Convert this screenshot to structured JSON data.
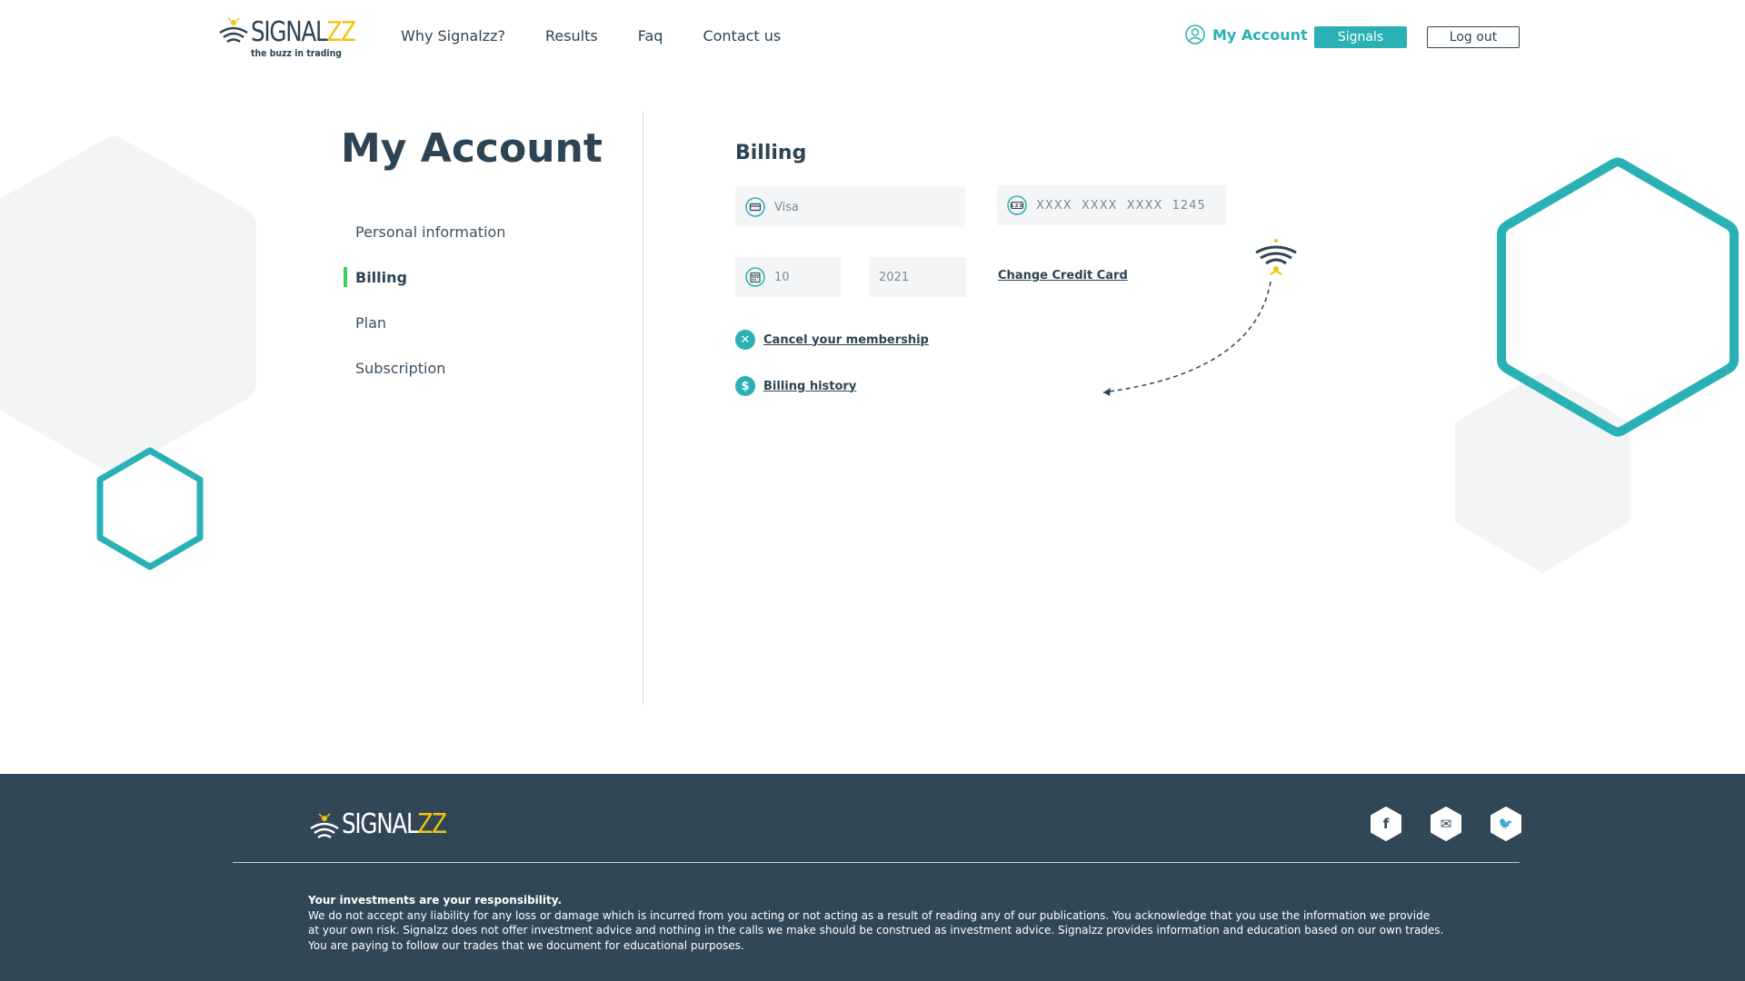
{
  "brand": {
    "name_dark": "SIGNAL",
    "name_accent": "ZZ",
    "tagline": "the buzz in trading",
    "colors": {
      "teal": "#29b1b5",
      "navy": "#2d4454",
      "yellow": "#f1c40f",
      "green": "#35d65c",
      "footer": "#314756"
    }
  },
  "nav": {
    "items": [
      "Why Signalzz?",
      "Results",
      "Faq",
      "Contact us"
    ],
    "account_label": "My Account",
    "account_icon": "user-circle-icon",
    "signals_label": "Signals",
    "logout_label": "Log out"
  },
  "sidebar": {
    "title": "My Account",
    "items": [
      {
        "label": "Personal information",
        "active": false
      },
      {
        "label": "Billing",
        "active": true
      },
      {
        "label": "Plan",
        "active": false
      },
      {
        "label": "Subscription",
        "active": false
      }
    ]
  },
  "billing": {
    "title": "Billing",
    "card_type": "Visa",
    "card_type_icon": "credit-card-icon",
    "card_number": "XXXX  XXXX  XXXX  1245",
    "card_number_icon": "number-123-icon",
    "exp_month": "10",
    "exp_month_icon": "calendar-icon",
    "exp_year": "2021",
    "change_card_label": "Change Credit Card",
    "cancel_label": "Cancel your membership",
    "cancel_icon": "close-icon",
    "history_label": "Billing history",
    "history_icon": "dollar-icon"
  },
  "footer": {
    "social": [
      {
        "name": "facebook-icon",
        "glyph": "f"
      },
      {
        "name": "mail-icon",
        "glyph": "✉"
      },
      {
        "name": "bird-icon",
        "glyph": "🐦"
      }
    ],
    "disclaimer_lead": "Your investments are your responsibility.",
    "disclaimer_line1": "We do not accept any liability for any loss or damage which is incurred from you acting or not acting as a result of reading any of our publications. You acknowledge that you use the information we provide",
    "disclaimer_line2": "at your own risk. Signalzz does not offer investment advice and nothing in the calls we make should be construed as investment advice. Signalzz provides information and education based on our own trades.",
    "disclaimer_line3": "You are paying to follow our trades that we document for educational purposes."
  }
}
